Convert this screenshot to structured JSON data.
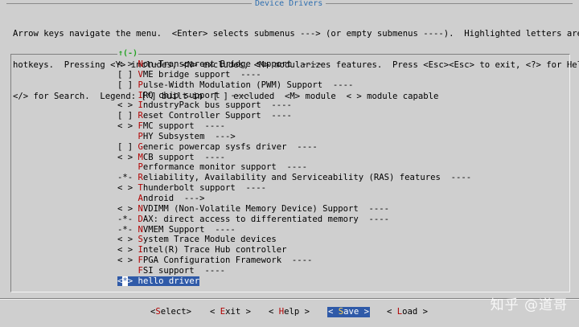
{
  "window": {
    "title": "Device Drivers"
  },
  "help_lines": [
    "Arrow keys navigate the menu.  <Enter> selects submenus ---> (or empty submenus ----).  Highlighted letters are",
    "hotkeys.  Pressing <Y> includes, <N> excludes, <M> modularizes features.  Press <Esc><Esc> to exit, <?> for Help,",
    "</> for Search.  Legend: [*] built-in  [ ] excluded  <M> module  < > module capable"
  ],
  "scroll_indicator": "↑(-)",
  "menu_items": [
    {
      "prefix": "< > ",
      "hotkey": "N",
      "rest": "on-Transparent Bridge support  ----"
    },
    {
      "prefix": "[ ] ",
      "hotkey": "V",
      "rest": "ME bridge support  ----"
    },
    {
      "prefix": "[ ] ",
      "hotkey": "P",
      "rest": "ulse-Width Modulation (PWM) Support  ----"
    },
    {
      "prefix": "    ",
      "hotkey": "I",
      "rest": "RQ chip support  ----"
    },
    {
      "prefix": "< > ",
      "hotkey": "I",
      "rest": "ndustryPack bus support  ----"
    },
    {
      "prefix": "[ ] ",
      "hotkey": "R",
      "rest": "eset Controller Support  ----"
    },
    {
      "prefix": "< > ",
      "hotkey": "F",
      "rest": "MC support  ----"
    },
    {
      "prefix": "    ",
      "hotkey": "P",
      "rest": "HY Subsystem  --->"
    },
    {
      "prefix": "[ ] ",
      "hotkey": "G",
      "rest": "eneric powercap sysfs driver  ----"
    },
    {
      "prefix": "< > ",
      "hotkey": "M",
      "rest": "CB support  ----"
    },
    {
      "prefix": "    ",
      "hotkey": "P",
      "rest": "erformance monitor support  ----"
    },
    {
      "prefix": "-*- ",
      "hotkey": "R",
      "rest": "eliability, Availability and Serviceability (RAS) features  ----"
    },
    {
      "prefix": "< > ",
      "hotkey": "T",
      "rest": "hunderbolt support  ----"
    },
    {
      "prefix": "    ",
      "hotkey": "A",
      "rest": "ndroid  --->"
    },
    {
      "prefix": "< > ",
      "hotkey": "N",
      "rest": "VDIMM (Non-Volatile Memory Device) Support  ----"
    },
    {
      "prefix": "-*- ",
      "hotkey": "D",
      "rest": "AX: direct access to differentiated memory  ----"
    },
    {
      "prefix": "-*- ",
      "hotkey": "N",
      "rest": "VMEM Support  ----"
    },
    {
      "prefix": "< > ",
      "hotkey": "S",
      "rest": "ystem Trace Module devices"
    },
    {
      "prefix": "< > ",
      "hotkey": "I",
      "rest": "ntel(R) Trace Hub controller"
    },
    {
      "prefix": "< > ",
      "hotkey": "F",
      "rest": "PGA Configuration Framework  ----"
    },
    {
      "prefix": "    ",
      "hotkey": "F",
      "rest": "SI support  ----"
    },
    {
      "prefix": "<",
      "cursor": "*",
      "prefix_end": "> ",
      "hotkey": "h",
      "rest": "ello driver",
      "selected": true
    }
  ],
  "buttons": [
    {
      "open": "<",
      "hotkey": "S",
      "rest": "elect",
      "close": ">",
      "active": false
    },
    {
      "open": "< ",
      "hotkey": "E",
      "rest": "xit",
      "close": " >",
      "active": false
    },
    {
      "open": "< ",
      "hotkey": "H",
      "rest": "elp",
      "close": " >",
      "active": false
    },
    {
      "open": "< ",
      "hotkey": "S",
      "rest": "ave",
      "close": " >",
      "active": true
    },
    {
      "open": "< ",
      "hotkey": "L",
      "rest": "oad",
      "close": " >",
      "active": false
    }
  ],
  "watermark": "知乎 @道哥",
  "colors": {
    "background": "#cfcfcf",
    "selection": "#2f5aa8",
    "hotkey": "#b00000",
    "title": "#2f6fb0"
  }
}
